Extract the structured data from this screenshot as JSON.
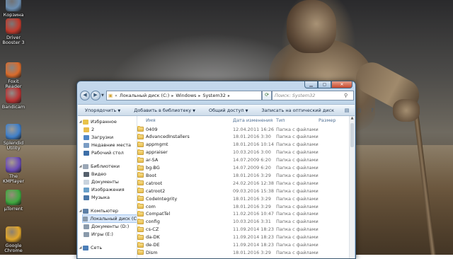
{
  "desktop": {
    "icons": [
      {
        "name": "recycle-bin",
        "label": "Корзина",
        "color": "#6b8db0"
      },
      {
        "name": "driver-booster",
        "label": "Driver Booster 3",
        "color": "#c0392b"
      },
      {
        "name": "foxit-reader",
        "label": "Foxit Reader",
        "color": "#d96b2b"
      },
      {
        "name": "bandicam",
        "label": "Bandicam",
        "color": "#b83232"
      },
      {
        "name": "splendid-utility",
        "label": "Splendid Utility",
        "color": "#3f7fc9"
      },
      {
        "name": "kmplayer",
        "label": "The KMPlayer",
        "color": "#6a4bb5"
      },
      {
        "name": "utorrent",
        "label": "µTorrent",
        "color": "#3ea83e"
      },
      {
        "name": "google-chrome",
        "label": "Google Chrome",
        "color": "#e0a52a"
      }
    ]
  },
  "window": {
    "address": {
      "segments": [
        "Локальный диск (C:)",
        "Windows",
        "System32"
      ]
    },
    "search_placeholder": "Поиск: System32",
    "toolbar": {
      "organize": "Упорядочить",
      "library": "Добавить в библиотеку",
      "share": "Общий доступ",
      "burn": "Записать на оптический диск"
    },
    "nav": {
      "favorites": "Избранное",
      "fav_2": "2",
      "downloads": "Загрузки",
      "recent": "Недавние места",
      "desktop": "Рабочий стол",
      "libraries": "Библиотеки",
      "video": "Видео",
      "documents": "Документы",
      "images": "Изображения",
      "music": "Музыка",
      "computer": "Компьютер",
      "local_c": "Локальный диск (C",
      "docs_d": "Документы (D:)",
      "games_e": "Игры (E:)",
      "network": "Сеть"
    },
    "columns": {
      "name": "Имя",
      "date": "Дата изменения",
      "type": "Тип",
      "size": "Размер"
    },
    "files": [
      {
        "name": "0409",
        "date": "12.04.2011 16:26",
        "type": "Папка с файлами"
      },
      {
        "name": "AdvancedInstallers",
        "date": "18.01.2016 3:30",
        "type": "Папка с файлами"
      },
      {
        "name": "appmgmt",
        "date": "18.01.2016 10:14",
        "type": "Папка с файлами"
      },
      {
        "name": "appraiser",
        "date": "10.03.2016 3:00",
        "type": "Папка с файлами"
      },
      {
        "name": "ar-SA",
        "date": "14.07.2009 6:20",
        "type": "Папка с файлами"
      },
      {
        "name": "bg-BG",
        "date": "14.07.2009 6:20",
        "type": "Папка с файлами"
      },
      {
        "name": "Boot",
        "date": "18.01.2016 3:29",
        "type": "Папка с файлами"
      },
      {
        "name": "catroot",
        "date": "24.02.2016 12:38",
        "type": "Папка с файлами"
      },
      {
        "name": "catroot2",
        "date": "09.03.2016 15:38",
        "type": "Папка с файлами"
      },
      {
        "name": "CodeIntegrity",
        "date": "18.01.2016 3:29",
        "type": "Папка с файлами"
      },
      {
        "name": "com",
        "date": "18.01.2016 3:29",
        "type": "Папка с файлами"
      },
      {
        "name": "CompatTel",
        "date": "11.02.2016 10:47",
        "type": "Папка с файлами"
      },
      {
        "name": "config",
        "date": "10.03.2016 3:31",
        "type": "Папка с файлами"
      },
      {
        "name": "cs-CZ",
        "date": "11.09.2014 18:23",
        "type": "Папка с файлами"
      },
      {
        "name": "da-DK",
        "date": "11.09.2014 18:23",
        "type": "Папка с файлами"
      },
      {
        "name": "de-DE",
        "date": "11.09.2014 18:23",
        "type": "Папка с файлами"
      },
      {
        "name": "Dism",
        "date": "18.01.2016 3:29",
        "type": "Папка с файлами"
      }
    ]
  }
}
